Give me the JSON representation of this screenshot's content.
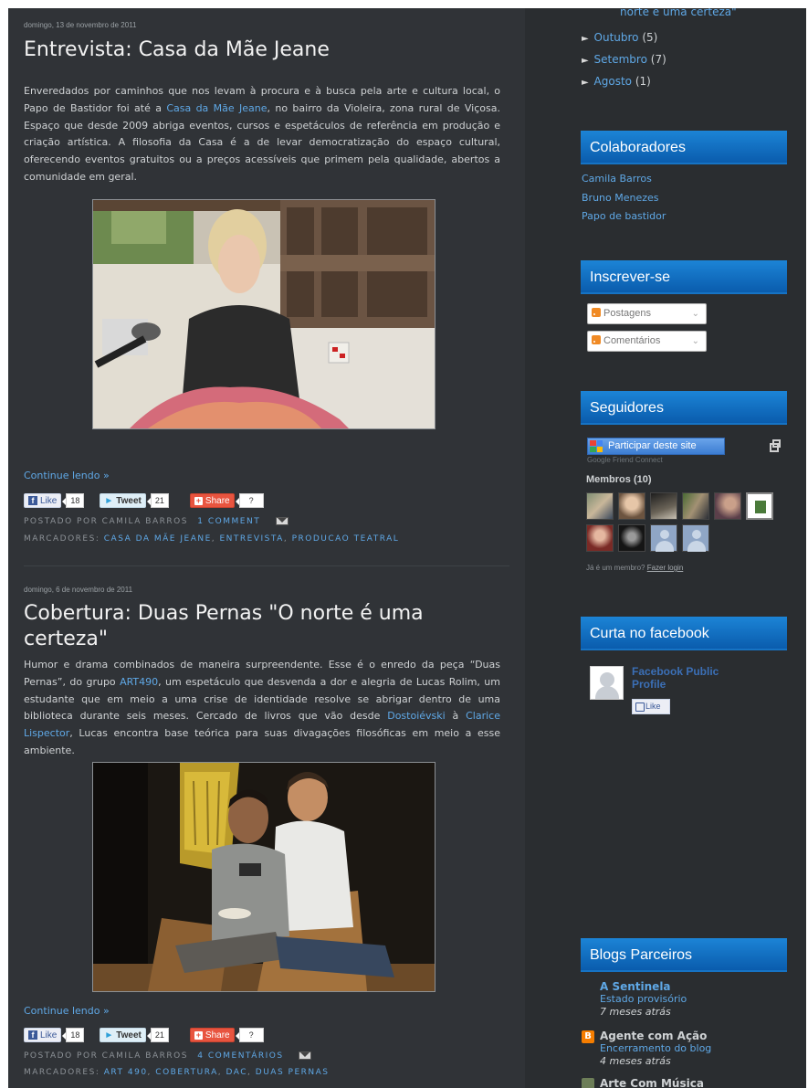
{
  "posts": [
    {
      "date": "domingo, 13 de novembro de 2011",
      "title": "Entrevista: Casa da Mãe Jeane",
      "body": {
        "p1": "Enveredados por caminhos que nos levam à procura e à busca pela arte e cultura local, o Papo de Bastidor foi até a ",
        "link1": "Casa da Mãe Jeane",
        "p2": ", no bairro da Violeira, zona rural de Viçosa. Espaço que desde 2009 abriga eventos, cursos e espetáculos de referência em produção e criação artística. A filosofia da Casa é a de levar democratização do espaço cultural, oferecendo eventos gratuitos ou a preços acessíveis que primem pela qualidade, abertos a comunidade em geral."
      },
      "continue": "Continue lendo »",
      "social": {
        "like": "Like",
        "like_count": "18",
        "tweet": "Tweet",
        "tweet_count": "21",
        "share": "Share",
        "share_count": "?"
      },
      "meta": {
        "posted_by": "POSTADO POR CAMILA BARROS",
        "comments": "1 COMMENT",
        "labels_prefix": "MARCADORES:",
        "labels": [
          "CASA DA MÃE JEANE",
          "ENTREVISTA",
          "PRODUCAO TEATRAL"
        ]
      }
    },
    {
      "date": "domingo, 6 de novembro de 2011",
      "title": "Cobertura: Duas Pernas \"O norte é uma certeza\"",
      "body": {
        "p1": "Humor e drama combinados de maneira surpreendente. Esse é o enredo da peça “Duas Pernas”, do grupo ",
        "link1": "ART490",
        "p2": ", um espetáculo que desvenda a dor e alegria de Lucas Rolim, um estudante que em meio a uma crise de identidade resolve se abrigar dentro de uma biblioteca durante seis meses. Cercado de livros que  vão desde ",
        "link2": "Dostoiévski",
        "p3": " à ",
        "link3": "Clarice Lispector",
        "p4": ", Lucas encontra base teórica para suas divagações filosóficas em meio a esse ambiente."
      },
      "continue": "Continue lendo »",
      "social": {
        "like": "Like",
        "like_count": "18",
        "tweet": "Tweet",
        "tweet_count": "21",
        "share": "Share",
        "share_count": "?"
      },
      "meta": {
        "posted_by": "POSTADO POR CAMILA BARROS",
        "comments": "4 COMENTÁRIOS",
        "labels_prefix": "MARCADORES:",
        "labels": [
          "ART 490",
          "COBERTURA",
          "DAC",
          "DUAS PERNAS"
        ]
      }
    }
  ],
  "sidebar": {
    "archive_top_fragment": "norte é uma certeza\"",
    "archive": [
      {
        "month": "Outubro",
        "count": "(5)"
      },
      {
        "month": "Setembro",
        "count": "(7)"
      },
      {
        "month": "Agosto",
        "count": "(1)"
      }
    ],
    "colaboradores": {
      "title": "Colaboradores",
      "items": [
        "Camila Barros",
        "Bruno Menezes",
        "Papo de bastidor"
      ]
    },
    "inscrever": {
      "title": "Inscrever-se",
      "options": [
        "Postagens",
        "Comentários"
      ]
    },
    "seguidores": {
      "title": "Seguidores",
      "join_button": "Participar deste site",
      "gfc_label": "Google Friend Connect",
      "members_title": "Membros (10)",
      "already_member": "Já é um membro?",
      "login_link": "Fazer login"
    },
    "facebook": {
      "title": "Curta no facebook",
      "profile_name": "Facebook Public Profile",
      "like": "Like"
    },
    "blogs": {
      "title": "Blogs Parceiros",
      "items": [
        {
          "name": "A Sentinela",
          "post": "Estado provisório",
          "time": "7 meses atrás"
        },
        {
          "name": "Agente com Ação",
          "post": "Encerramento do blog",
          "time": "4 meses atrás"
        },
        {
          "name": "Arte Com Música",
          "post": "",
          "time": ""
        }
      ]
    }
  },
  "colors": {
    "page_bg": "#303337",
    "sidebar_bg": "#2a2d30",
    "link": "#5fa8e6",
    "widget_header": "#0a6fc8"
  }
}
